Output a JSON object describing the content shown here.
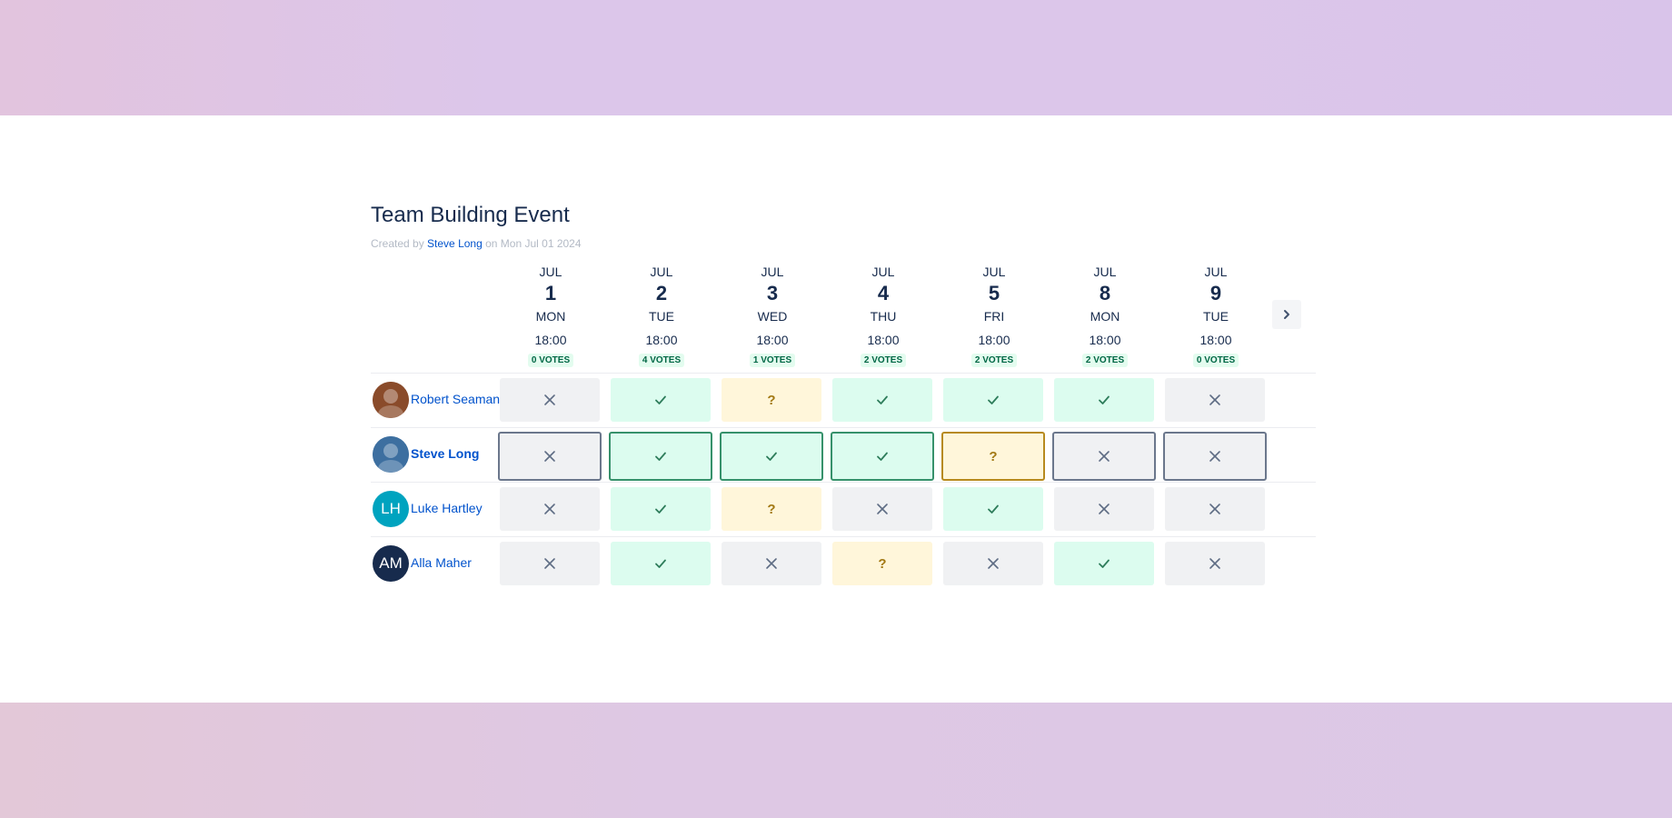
{
  "poll": {
    "title": "Team Building Event",
    "created_prefix": "Created by",
    "creator": "Steve Long",
    "created_on": "on Mon Jul 01 2024",
    "next_icon": "chevron-right-icon"
  },
  "columns": [
    {
      "month": "JUL",
      "day": "1",
      "dow": "MON",
      "time": "18:00",
      "votes": "0 VOTES"
    },
    {
      "month": "JUL",
      "day": "2",
      "dow": "TUE",
      "time": "18:00",
      "votes": "4 VOTES"
    },
    {
      "month": "JUL",
      "day": "3",
      "dow": "WED",
      "time": "18:00",
      "votes": "1 VOTES"
    },
    {
      "month": "JUL",
      "day": "4",
      "dow": "THU",
      "time": "18:00",
      "votes": "2 VOTES"
    },
    {
      "month": "JUL",
      "day": "5",
      "dow": "FRI",
      "time": "18:00",
      "votes": "2 VOTES"
    },
    {
      "month": "JUL",
      "day": "8",
      "dow": "MON",
      "time": "18:00",
      "votes": "2 VOTES"
    },
    {
      "month": "JUL",
      "day": "9",
      "dow": "TUE",
      "time": "18:00",
      "votes": "0 VOTES"
    }
  ],
  "participants": [
    {
      "name": "Robert Seaman",
      "initials": "",
      "avatar_color": "#8a4b2a",
      "avatar_type": "photo",
      "current": false,
      "answers": [
        "no",
        "yes",
        "maybe",
        "yes",
        "yes",
        "yes",
        "no"
      ]
    },
    {
      "name": "Steve Long",
      "initials": "",
      "avatar_color": "#3d6fa0",
      "avatar_type": "photo",
      "current": true,
      "answers": [
        "no",
        "yes",
        "yes",
        "yes",
        "maybe",
        "no",
        "no"
      ]
    },
    {
      "name": "Luke Hartley",
      "initials": "LH",
      "avatar_color": "#00a3bf",
      "avatar_type": "initials",
      "current": false,
      "answers": [
        "no",
        "yes",
        "maybe",
        "no",
        "yes",
        "no",
        "no"
      ]
    },
    {
      "name": "Alla Maher",
      "initials": "AM",
      "avatar_color": "#172b4d",
      "avatar_type": "initials",
      "current": false,
      "answers": [
        "no",
        "yes",
        "no",
        "maybe",
        "no",
        "yes",
        "no"
      ]
    }
  ],
  "answer_icons": {
    "yes": "check-icon",
    "no": "cross-icon",
    "maybe": "question-icon"
  },
  "colors": {
    "yes_bg": "#dcfcef",
    "no_bg": "#f0f1f3",
    "maybe_bg": "#fff6da",
    "link": "#0052cc",
    "text": "#172b4d"
  }
}
